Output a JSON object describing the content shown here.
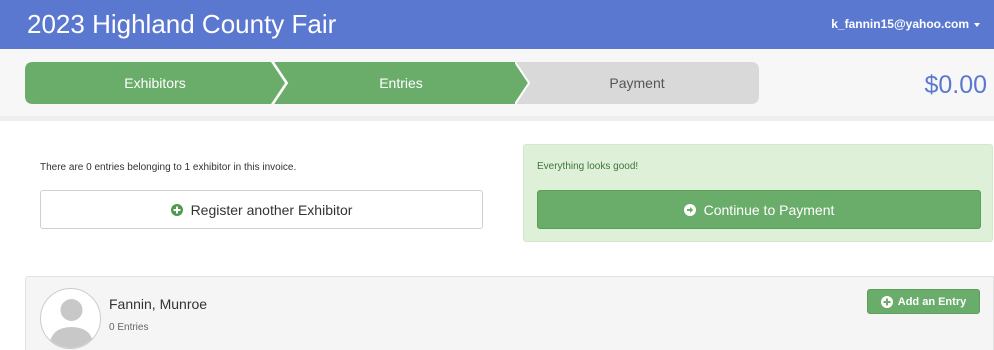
{
  "header": {
    "title": "2023 Highland County Fair",
    "user_email": "k_fannin15@yahoo.com"
  },
  "steps": [
    {
      "label": "Exhibitors",
      "state": "complete"
    },
    {
      "label": "Entries",
      "state": "complete"
    },
    {
      "label": "Payment",
      "state": "pending"
    }
  ],
  "total": "$0.00",
  "summary": {
    "info_text": "There are 0 entries belonging to 1 exhibitor in this invoice.",
    "register_label": "Register another Exhibitor"
  },
  "status": {
    "message": "Everything looks good!",
    "continue_label": "Continue to Payment"
  },
  "exhibitor": {
    "name": "Fannin, Munroe",
    "entries_count": "0 Entries",
    "add_entry_label": "Add an Entry"
  },
  "colors": {
    "brand_blue": "#5b78d0",
    "step_done": "#6aad6a",
    "step_pending": "#d9d9d9",
    "success_bg": "#dff0d8",
    "success_text": "#3c763d"
  },
  "icons": {
    "user_menu": "chevron-down-icon",
    "register": "plus-circle-icon",
    "continue": "arrow-right-circle-icon",
    "add_entry": "plus-circle-icon",
    "avatar": "person-silhouette-icon"
  }
}
